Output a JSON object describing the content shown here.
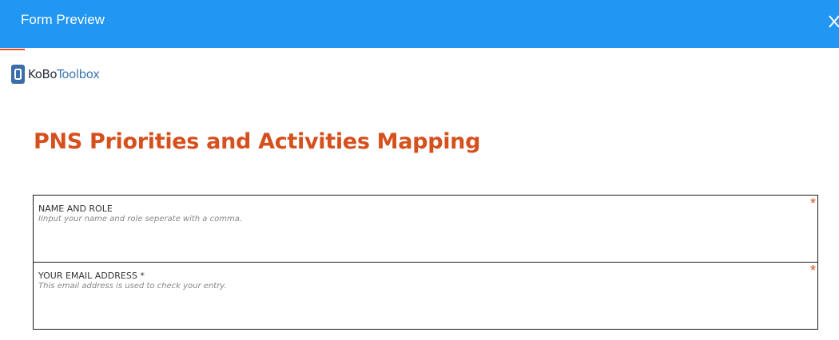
{
  "header": {
    "title": "Form Preview",
    "close_icon": "close-icon",
    "background_color": "#2196f3"
  },
  "brand": {
    "logo_icon": "kobo-logo-icon",
    "name_part1": "KoBo",
    "name_part2": "Toolbox"
  },
  "form": {
    "title": "PNS Priorities and Activities Mapping",
    "title_color": "#d5501d",
    "questions": [
      {
        "label": "NAME AND ROLE",
        "hint": "IInput your name and role seperate with a comma.",
        "required_marker": "*"
      },
      {
        "label": "YOUR EMAIL ADDRESS *",
        "hint": "This email address is used to check your entry.",
        "required_marker": "*"
      }
    ]
  }
}
